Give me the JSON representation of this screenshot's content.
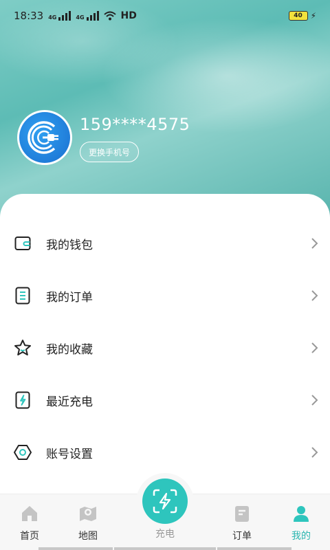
{
  "status_bar": {
    "time": "18:33",
    "signal1_label": "4G",
    "signal2_label": "4G",
    "network": "HD",
    "battery": "40"
  },
  "profile": {
    "phone": "159****4575",
    "change_phone_label": "更换手机号",
    "avatar_icon": "charging-plug-icon"
  },
  "menu": {
    "items": [
      {
        "label": "我的钱包",
        "icon": "wallet-icon"
      },
      {
        "label": "我的订单",
        "icon": "order-list-icon"
      },
      {
        "label": "我的收藏",
        "icon": "star-icon"
      },
      {
        "label": "最近充电",
        "icon": "charging-bolt-icon"
      },
      {
        "label": "账号设置",
        "icon": "settings-hex-icon"
      }
    ]
  },
  "tabbar": {
    "tabs": [
      {
        "label": "首页",
        "icon": "home-icon"
      },
      {
        "label": "地图",
        "icon": "map-icon"
      },
      {
        "label": "充电",
        "icon": "scan-charge-icon"
      },
      {
        "label": "订单",
        "icon": "order-icon"
      },
      {
        "label": "我的",
        "icon": "user-icon",
        "active": true
      }
    ]
  },
  "colors": {
    "accent": "#2ec5bd",
    "hero": "#6cc4bd"
  }
}
